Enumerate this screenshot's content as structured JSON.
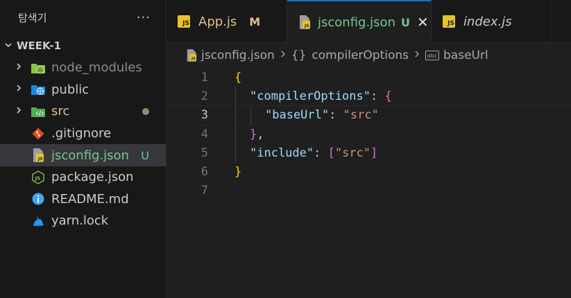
{
  "sidebar": {
    "title": "탐색기",
    "more": "···",
    "section": "WEEK-1",
    "items": [
      {
        "label": "node_modules",
        "icon": "node-modules-folder-icon",
        "type": "folder"
      },
      {
        "label": "public",
        "icon": "public-folder-icon",
        "type": "folder"
      },
      {
        "label": "src",
        "icon": "src-folder-icon",
        "type": "folder"
      },
      {
        "label": ".gitignore",
        "icon": "git-icon",
        "type": "file"
      },
      {
        "label": "jsconfig.json",
        "icon": "jsconfig-icon",
        "type": "file",
        "decoration": "U"
      },
      {
        "label": "package.json",
        "icon": "nodejs-icon",
        "type": "file"
      },
      {
        "label": "README.md",
        "icon": "info-icon",
        "type": "file"
      },
      {
        "label": "yarn.lock",
        "icon": "yarn-icon",
        "type": "file"
      }
    ]
  },
  "tabs": [
    {
      "label": "App.js",
      "decoration": "M",
      "icon_text": "JS"
    },
    {
      "label": "jsconfig.json",
      "decoration": "U",
      "icon_text": "JS",
      "close": "✕"
    },
    {
      "label": "index.js",
      "icon_text": "JS"
    }
  ],
  "breadcrumbs": {
    "file": "jsconfig.json",
    "obj_icon": "{}",
    "section": "compilerOptions",
    "prop_icon": "abc",
    "leaf": "baseUrl"
  },
  "editor": {
    "line_numbers": [
      "1",
      "2",
      "3",
      "4",
      "5",
      "6",
      "7"
    ],
    "current_line": 3,
    "code": {
      "l1_open": "{",
      "l2_key": "\"compilerOptions\"",
      "l2_colon": ": ",
      "l2_open": "{",
      "l3_key": "\"baseUrl\"",
      "l3_colon": ": ",
      "l3_val": "\"src\"",
      "l4_close": "}",
      "l4_comma": ",",
      "l5_key": "\"include\"",
      "l5_colon": ": ",
      "l5_open": "[",
      "l5_val": "\"src\"",
      "l5_close": "]",
      "l6_close": "}"
    }
  },
  "colors": {
    "accent": "#0078d4",
    "js_badge": "#e8c22a",
    "untracked": "#73c991",
    "modified": "#e2c08d"
  }
}
